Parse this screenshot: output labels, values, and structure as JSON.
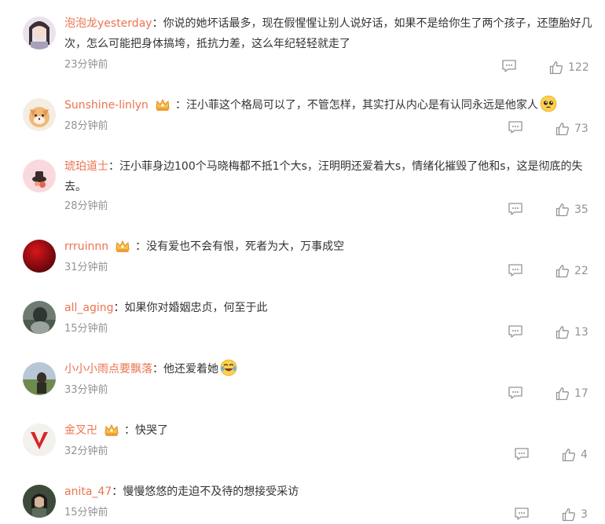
{
  "comments": [
    {
      "name": "泡泡龙yesterday",
      "sep": "：",
      "text": "你说的她坏话最多，现在假惺惺让别人说好话，如果不是给你生了两个孩子，还堕胎好几次，怎么可能把身体搞垮，抵抗力差，这么年纪轻轻就走了",
      "time": "23分钟前",
      "likes": "122"
    },
    {
      "name": "Sunshine-linlyn",
      "sep": "：",
      "text": "汪小菲这个格局可以了，不管怎样，其实打从内心是有认同永远是他家人",
      "time": "28分钟前",
      "likes": "73"
    },
    {
      "name": "琥珀道士",
      "sep": "：",
      "text": "汪小菲身边100个马晓梅都不抵1个大s，汪明明还爱着大s，情绪化摧毁了他和s，这是彻底的失去。",
      "time": "28分钟前",
      "likes": "35"
    },
    {
      "name": "rrruinnn",
      "sep": "：",
      "text": "没有爱也不会有恨，死者为大，万事成空",
      "time": "31分钟前",
      "likes": "22"
    },
    {
      "name": "all_aging",
      "sep": "：",
      "text": "如果你对婚姻忠贞，何至于此",
      "time": "15分钟前",
      "likes": "13"
    },
    {
      "name": "小小小雨点要飘落",
      "sep": "：",
      "text": "他还爱着她",
      "time": "33分钟前",
      "likes": "17"
    },
    {
      "name": "金叉卍",
      "sep": "：",
      "text": "快哭了",
      "time": "32分钟前",
      "likes": "4"
    },
    {
      "name": "anita_47",
      "sep": "：",
      "text": "慢慢悠悠的走迫不及待的想接受采访",
      "time": "15分钟前",
      "likes": "3"
    }
  ]
}
